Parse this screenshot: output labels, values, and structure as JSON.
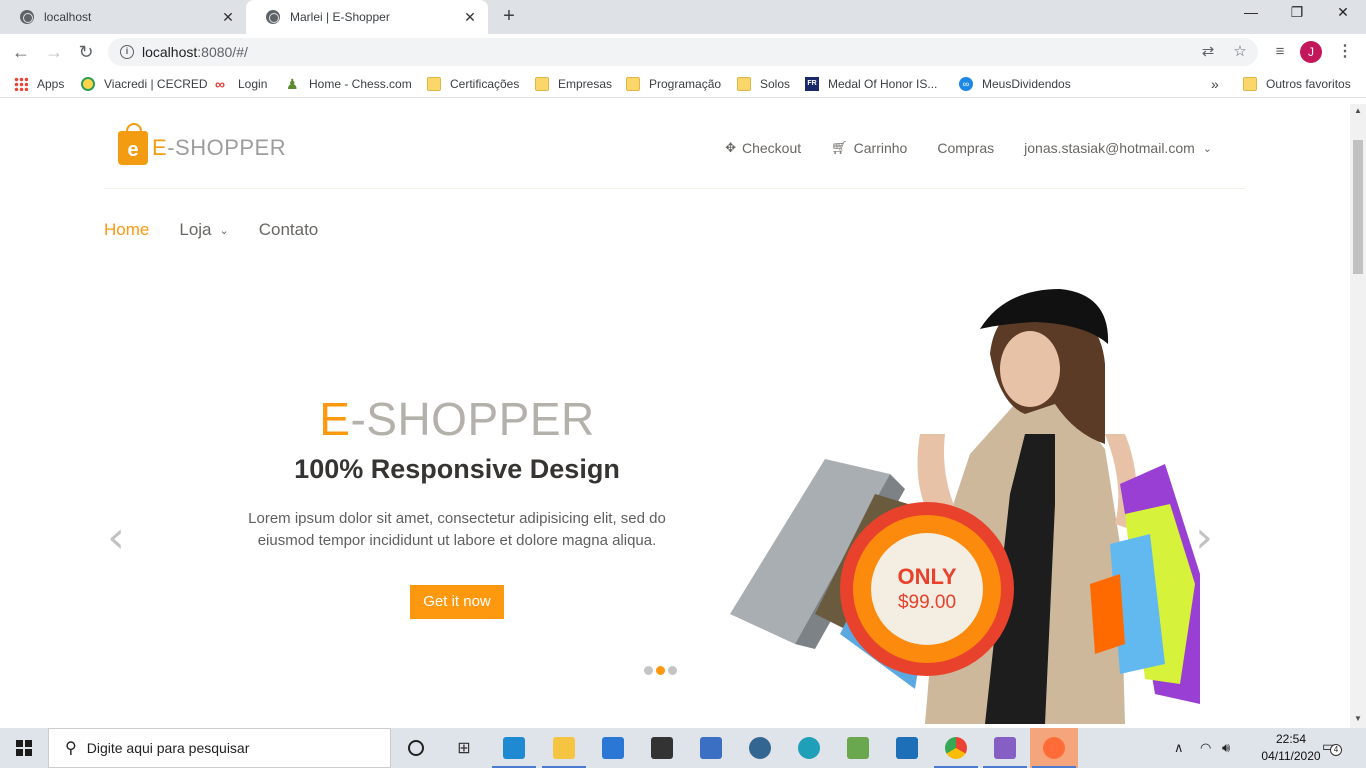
{
  "browser": {
    "tabs": [
      {
        "title": "localhost",
        "active": false
      },
      {
        "title": "Marlei | E-Shopper",
        "active": true
      }
    ],
    "address": {
      "host": "localhost",
      "rest": ":8080/#/"
    },
    "profile_initial": "J",
    "bookmarks": [
      {
        "label": "Apps",
        "icon": "apps-grid-icon"
      },
      {
        "label": "Viacredi | CECRED",
        "icon": "viacredi-icon"
      },
      {
        "label": "Login",
        "icon": "infinity-icon"
      },
      {
        "label": "Home - Chess.com",
        "icon": "chess-pawn-icon"
      },
      {
        "label": "Certificações",
        "icon": "folder-icon"
      },
      {
        "label": "Empresas",
        "icon": "folder-icon"
      },
      {
        "label": "Programação",
        "icon": "folder-icon"
      },
      {
        "label": "Solos",
        "icon": "folder-icon"
      },
      {
        "label": "Medal Of Honor IS...",
        "icon": "fr-icon"
      },
      {
        "label": "MeusDividendos",
        "icon": "link-icon"
      }
    ],
    "bookmarks_overflow": "»",
    "other_bookmarks": "Outros favoritos"
  },
  "site": {
    "logo": {
      "letter": "e",
      "prefix": "E",
      "rest": "-SHOPPER"
    },
    "header_menu": [
      {
        "label": "Checkout",
        "icon": "crosshair-icon"
      },
      {
        "label": "Carrinho",
        "icon": "cart-icon"
      },
      {
        "label": "Compras",
        "icon": ""
      },
      {
        "label": "jonas.stasiak@hotmail.com",
        "icon": "chevron-down-icon"
      }
    ],
    "nav": [
      {
        "label": "Home",
        "active": true
      },
      {
        "label": "Loja",
        "dropdown": true
      },
      {
        "label": "Contato"
      }
    ],
    "slider": {
      "title_prefix": "E",
      "title_rest": "-SHOPPER",
      "subtitle": "100% Responsive Design",
      "text_line1": "Lorem ipsum dolor sit amet, consectetur adipisicing elit, sed do",
      "text_line2": "eiusmod tempor incididunt ut labore et dolore magna aliqua.",
      "button": "Get it now",
      "badge_only": "ONLY",
      "badge_price": "$99.00",
      "active_slide": 2,
      "slide_count": 3
    }
  },
  "taskbar": {
    "search_placeholder": "Digite aqui para pesquisar",
    "time": "22:54",
    "date": "04/11/2020",
    "notifications": "4"
  },
  "colors": {
    "accent": "#fe980f",
    "badge_red": "#e8412c"
  }
}
